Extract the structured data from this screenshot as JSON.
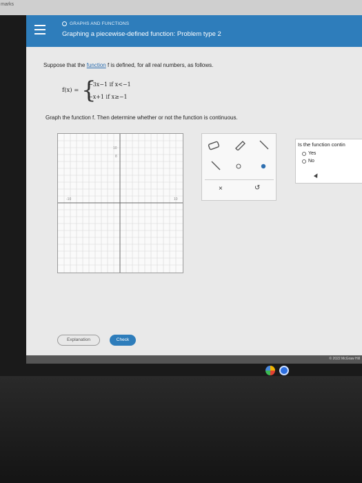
{
  "top_strip": {
    "text": "marks"
  },
  "header": {
    "category": "GRAPHS AND FUNCTIONS",
    "title": "Graphing a piecewise-defined function: Problem type 2"
  },
  "problem": {
    "intro_before_link": "Suppose that the ",
    "link_text": "function",
    "intro_after_link": " f is defined, for all real numbers, as follows.",
    "fx_label": "f(x) =",
    "case1": "−3x−1  if x<−1",
    "case2": "−x+1  if x≥−1",
    "instruction": "Graph the function f. Then determine whether or not the function is continuous."
  },
  "graph": {
    "x_min": -10,
    "x_max": 10,
    "y_min": -10,
    "y_max": 10,
    "tick_labels": {
      "y_top": "10",
      "y_mid_pos": "8",
      "x_left": "-10",
      "x_right": "10"
    }
  },
  "toolbox": {
    "tools": [
      "eraser-icon",
      "pencil-icon",
      "line-segment-icon",
      "ray-icon",
      "open-point-icon",
      "closed-point-icon"
    ],
    "clear_label": "×",
    "undo_label": "↺"
  },
  "side_panel": {
    "question": "Is the function contin",
    "options": [
      "Yes",
      "No"
    ]
  },
  "buttons": {
    "explanation": "Explanation",
    "check": "Check"
  },
  "footer": {
    "copyright": "© 2022 McGraw Hill"
  },
  "colors": {
    "header": "#2e7dbb",
    "background": "#e9e9e9",
    "check_button": "#2e7dbb"
  }
}
